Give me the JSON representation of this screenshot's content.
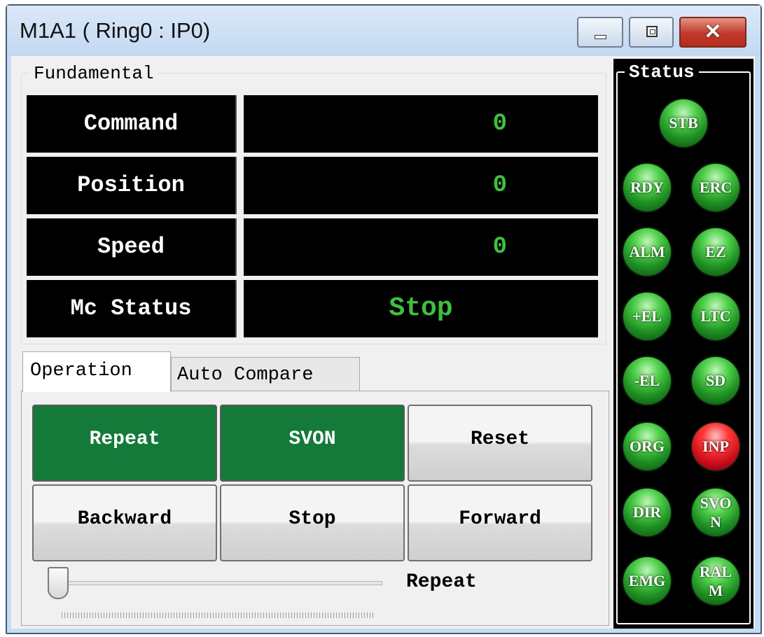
{
  "window": {
    "title": "M1A1 ( Ring0 : IP0)",
    "minimize_label": "minimize",
    "maximize_label": "maximize",
    "close_glyph": "✕"
  },
  "fundamental": {
    "label": "Fundamental",
    "rows": [
      {
        "label": "Command",
        "value": "0"
      },
      {
        "label": "Position",
        "value": "0"
      },
      {
        "label": "Speed",
        "value": "0"
      },
      {
        "label": "Mc Status",
        "value": "Stop"
      }
    ]
  },
  "tabs": [
    {
      "label": "Operation",
      "active": true
    },
    {
      "label": "Auto Compare",
      "active": false
    }
  ],
  "operation": {
    "buttons": [
      {
        "label": "Repeat",
        "state": "on"
      },
      {
        "label": "SVON",
        "state": "on"
      },
      {
        "label": "Reset",
        "state": "off"
      },
      {
        "label": "Backward",
        "state": "off"
      },
      {
        "label": "Stop",
        "state": "off"
      },
      {
        "label": "Forward",
        "state": "off"
      }
    ],
    "slider": {
      "label": "Repeat",
      "value": 0
    }
  },
  "status": {
    "label": "Status",
    "leds": [
      {
        "label": "STB",
        "color": "green"
      },
      {
        "label": "RDY",
        "color": "green"
      },
      {
        "label": "ERC",
        "color": "green"
      },
      {
        "label": "ALM",
        "color": "green"
      },
      {
        "label": "EZ",
        "color": "green"
      },
      {
        "label": "+EL",
        "color": "green"
      },
      {
        "label": "LTC",
        "color": "green"
      },
      {
        "label": "-EL",
        "color": "green"
      },
      {
        "label": "SD",
        "color": "green"
      },
      {
        "label": "ORG",
        "color": "green"
      },
      {
        "label": "INP",
        "color": "red"
      },
      {
        "label": "DIR",
        "color": "green"
      },
      {
        "label": "SVON",
        "color": "green"
      },
      {
        "label": "EMG",
        "color": "green"
      },
      {
        "label": "RALM",
        "color": "green"
      }
    ]
  },
  "colors": {
    "button_on": "#147a3a",
    "value_text": "#3fbf3f",
    "led_green": "#1e8f22",
    "led_red": "#d0101c"
  }
}
